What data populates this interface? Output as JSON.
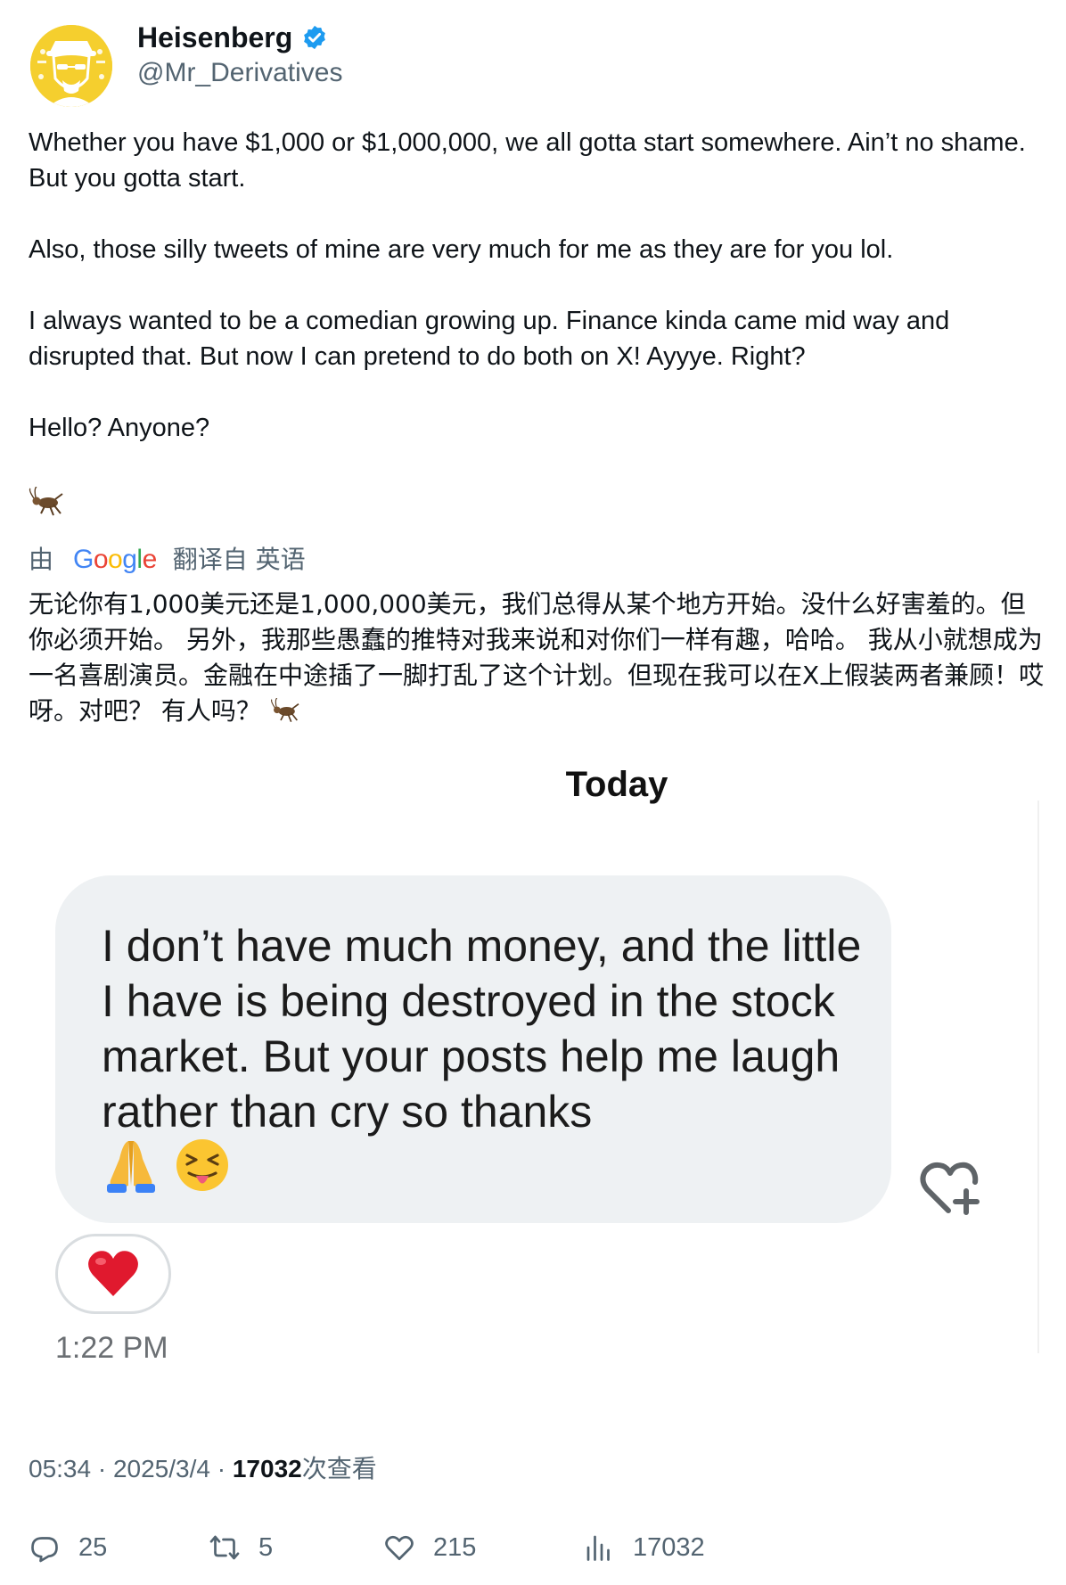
{
  "author": {
    "name": "Heisenberg",
    "handle": "@Mr_Derivatives",
    "verified_color": "#1d9bf0",
    "avatar_color": "#f5cf2e"
  },
  "tweet": {
    "text": "Whether you have $1,000 or $1,000,000, we all gotta start somewhere. Ain’t no shame. But you gotta start.\n\nAlso, those silly tweets of mine are very much for me as they are for you lol.\n\nI always wanted to be a comedian growing up. Finance kinda came mid way and disrupted that. But now I can pretend to do both on X! Ayyye. Right?\n\nHello? Anyone?",
    "trailing_emoji": "cricket-icon"
  },
  "translation": {
    "prefix": "由",
    "provider": "Google",
    "suffix": "翻译自 英语",
    "text": "无论你有1,000美元还是1,000,000美元，我们总得从某个地方开始。没什么好害羞的。但你必须开始。 另外，我那些愚蠢的推特对我来说和对你们一样有趣，哈哈。 我从小就想成为一名喜剧演员。金融在中途插了一脚打乱了这个计划。但现在我可以在X上假装两者兼顾！哎呀。对吧？ 有人吗？"
  },
  "embedded_message": {
    "day_label": "Today",
    "message": "I don’t have much money, and the little I have is being destroyed in the stock market. But your posts help me laugh rather than cry so thanks",
    "emojis": [
      "folded-hands-icon",
      "squinting-tongue-face-icon"
    ],
    "reaction": "red-heart-icon",
    "time": "1:22 PM"
  },
  "meta": {
    "time": "05:34",
    "separator": " · ",
    "date": "2025/3/4",
    "views_count": "17032",
    "views_label": "次查看"
  },
  "actions": {
    "replies": "25",
    "reposts": "5",
    "likes": "215",
    "views": "17032"
  }
}
